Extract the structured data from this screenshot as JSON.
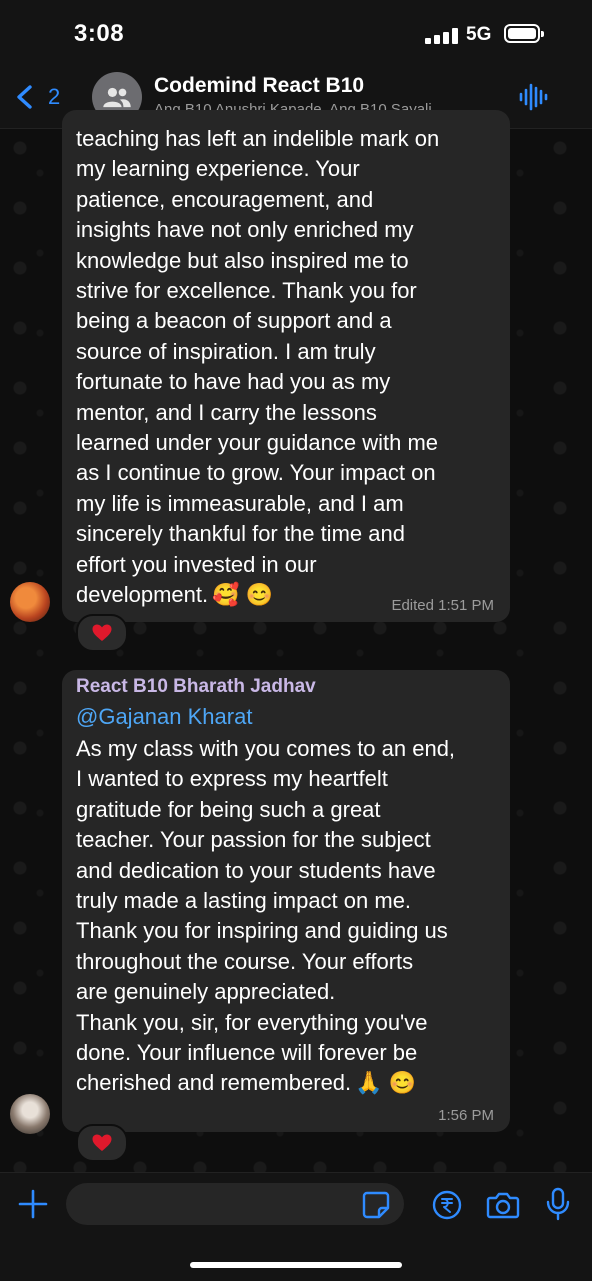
{
  "status_bar": {
    "time": "3:08",
    "network": "5G"
  },
  "header": {
    "back_count": "2",
    "title": "Codemind React B10",
    "subtitle": "Ang B10 Anushri Kapade, Ang B10 Sayali..."
  },
  "messages": [
    {
      "text": "teaching has left an indelible mark on\nmy learning experience. Your\npatience, encouragement, and\ninsights have not only enriched my\nknowledge but also inspired me to\nstrive for excellence. Thank you for\nbeing a beacon of support and a\nsource of inspiration. I am truly\nfortunate to have had you as my\nmentor, and I carry the lessons\nlearned under your guidance with me\nas I continue to grow. Your impact on\nmy life is immeasurable, and I am\nsincerely thankful for the time and\neffort you invested in our\ndevelopment.",
      "emoji": "🥰 😊",
      "meta": "Edited  1:51 PM",
      "reaction": "heart"
    },
    {
      "sender": "React B10 Bharath Jadhav",
      "mention": "@Gajanan Kharat",
      "text": "As my class with you comes to an end,\nI wanted to express my heartfelt\ngratitude for being such a great\nteacher. Your passion for the subject\nand dedication to your students have\ntruly made a lasting impact on me.\nThank you for inspiring and guiding us\nthroughout the course. Your efforts\nare genuinely appreciated.\nThank you, sir, for everything you've\ndone. Your influence will forever be\ncherished and remembered.",
      "emoji": "🙏 😊",
      "meta": "1:56 PM",
      "reaction": "heart"
    }
  ],
  "composer": {
    "input_value": ""
  },
  "colors": {
    "accent": "#2f8bff",
    "bubble": "#262626",
    "sender_name": "#c9b8e6",
    "mention": "#4ea6f5",
    "heart": "#e0192c"
  }
}
